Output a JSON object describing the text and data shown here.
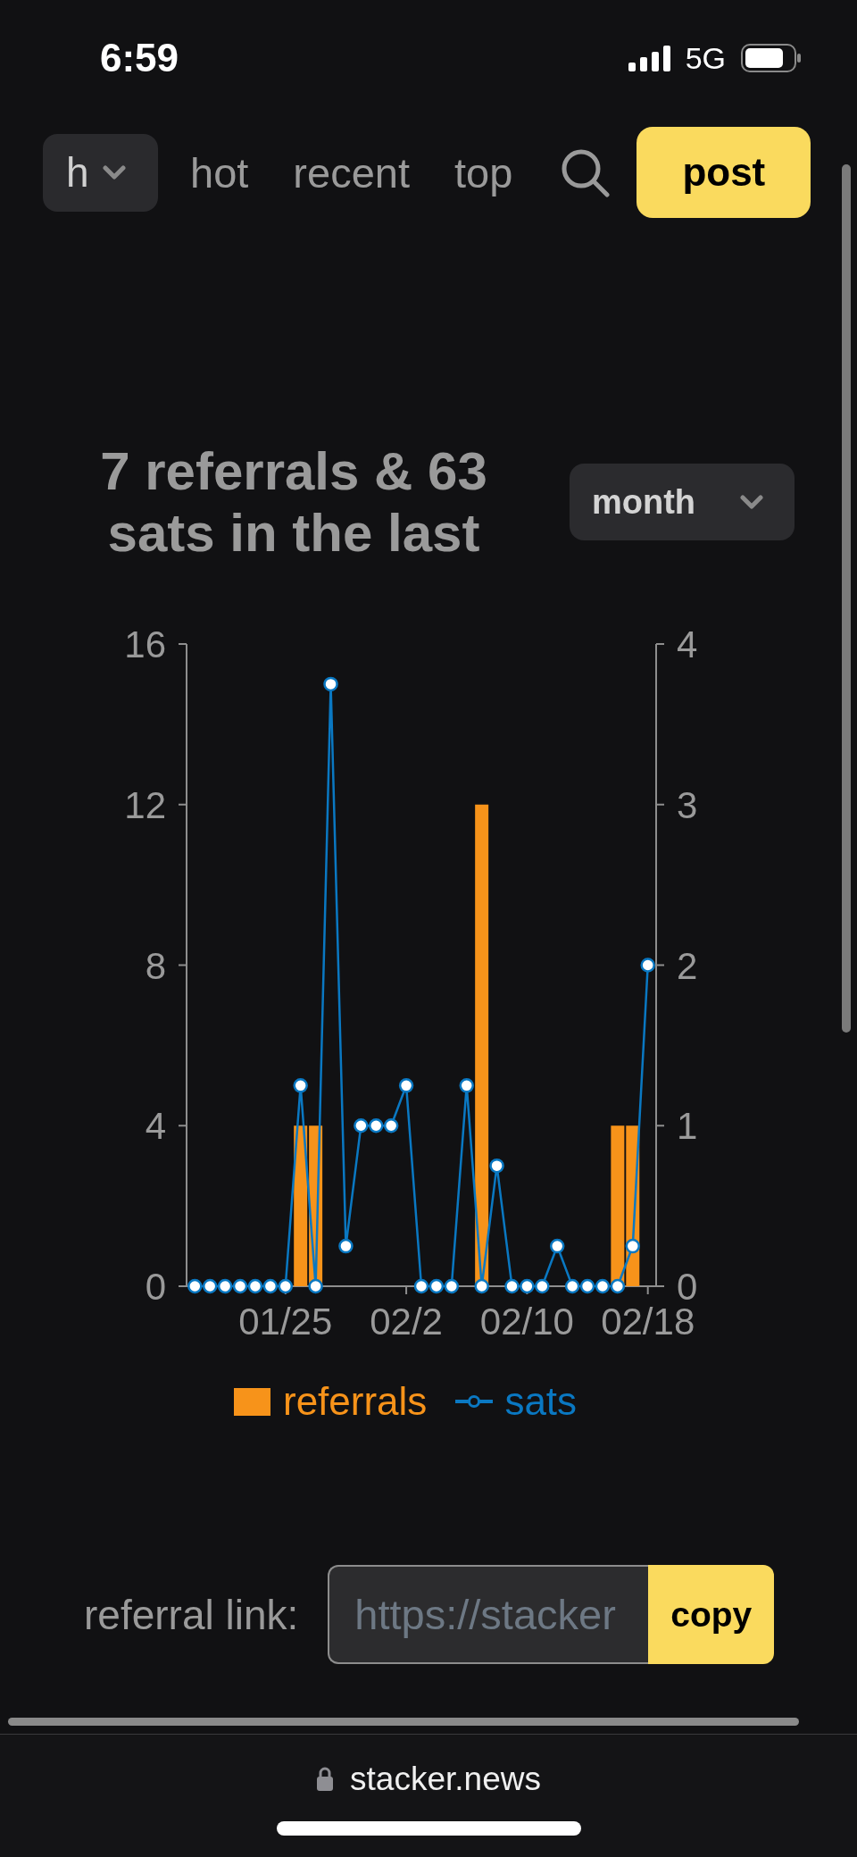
{
  "status_bar": {
    "time": "6:59",
    "network": "5G"
  },
  "nav": {
    "territory_select": {
      "value": "h"
    },
    "tabs": [
      {
        "label": "hot",
        "selected": false
      },
      {
        "label": "recent",
        "selected": false
      },
      {
        "label": "top",
        "selected": false
      }
    ],
    "post_button": "post"
  },
  "referrals": {
    "title": "7 referrals & 63 sats in the last",
    "period_select": {
      "value": "month"
    },
    "chart_data": {
      "type": "bar",
      "categories": [
        null,
        null,
        null,
        null,
        null,
        null,
        "01/25",
        null,
        null,
        null,
        null,
        null,
        null,
        null,
        "02/2",
        null,
        null,
        null,
        null,
        null,
        null,
        null,
        "02/10",
        null,
        null,
        null,
        null,
        null,
        null,
        null,
        "02/18"
      ],
      "ylim": [
        0,
        16
      ],
      "yticks": [
        0,
        4,
        8,
        12,
        16
      ],
      "y2lim": [
        0,
        4
      ],
      "y2ticks": [
        0,
        1,
        2,
        3,
        4
      ],
      "legend": "bottom",
      "series": [
        {
          "name": "referrals",
          "axis": "y2",
          "color": "#f7931a",
          "values": [
            0,
            0,
            0,
            0,
            0,
            0,
            0,
            1,
            1,
            0,
            0,
            0,
            0,
            0,
            0,
            0,
            0,
            0,
            0,
            3,
            0,
            0,
            0,
            0,
            0,
            0,
            0,
            0,
            1,
            1,
            0
          ]
        },
        {
          "name": "sats",
          "type": "line",
          "marker": "circle",
          "color": "#0a78c2",
          "values": [
            0,
            0,
            0,
            0,
            0,
            0,
            0,
            5,
            0,
            15,
            1,
            4,
            4,
            4,
            5,
            0,
            0,
            0,
            5,
            0,
            3,
            0,
            0,
            0,
            1,
            0,
            0,
            0,
            0,
            1,
            8
          ]
        }
      ]
    }
  },
  "referral_link": {
    "label": "referral link:",
    "value": "https://stacker",
    "button": "copy"
  },
  "browser_bar": {
    "url": "stacker.news"
  }
}
